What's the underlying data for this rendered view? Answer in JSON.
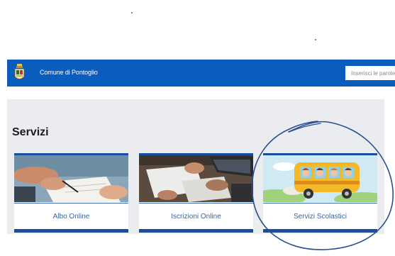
{
  "header": {
    "site_name": "Comune di Pontoglio",
    "search_placeholder": "Inserisci le parole"
  },
  "servizi": {
    "title": "Servizi",
    "cards": [
      {
        "label": "Albo Online"
      },
      {
        "label": "Iscrizioni Online"
      },
      {
        "label": "Servizi Scolastici"
      }
    ]
  },
  "colors": {
    "header_blue": "#0b5dbd",
    "card_accent": "#174e9d",
    "link_text": "#2f65ad",
    "section_bg": "#ebecef",
    "annotation_ink": "#2a4f8f"
  },
  "icons": [
    "comune-crest-icon"
  ]
}
